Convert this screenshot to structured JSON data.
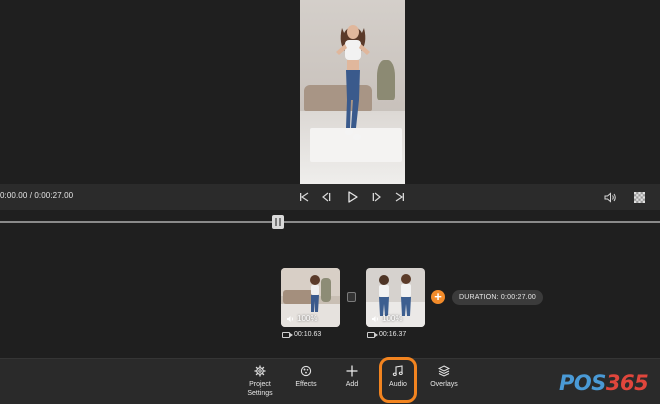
{
  "transport": {
    "timecode": "0:00.00 / 0:00:27.00"
  },
  "timeline": {
    "clips": [
      {
        "volume": "100%",
        "duration": "00:10.63"
      },
      {
        "volume": "100%",
        "duration": "00:16.37"
      }
    ],
    "duration_label": "DURATION: 0:00:27.00"
  },
  "toolbar": {
    "items": [
      {
        "label": "Project\nSettings",
        "icon": "gear-icon"
      },
      {
        "label": "Effects",
        "icon": "effects-icon"
      },
      {
        "label": "Add",
        "icon": "plus-icon"
      },
      {
        "label": "Audio",
        "icon": "music-note-icon"
      },
      {
        "label": "Overlays",
        "icon": "layers-icon"
      }
    ]
  },
  "watermark": {
    "text_pos": "POS",
    "text_num": "365"
  },
  "colors": {
    "accent": "#f28420",
    "background": "#1f1f1f",
    "panel": "#2b2b2b"
  }
}
